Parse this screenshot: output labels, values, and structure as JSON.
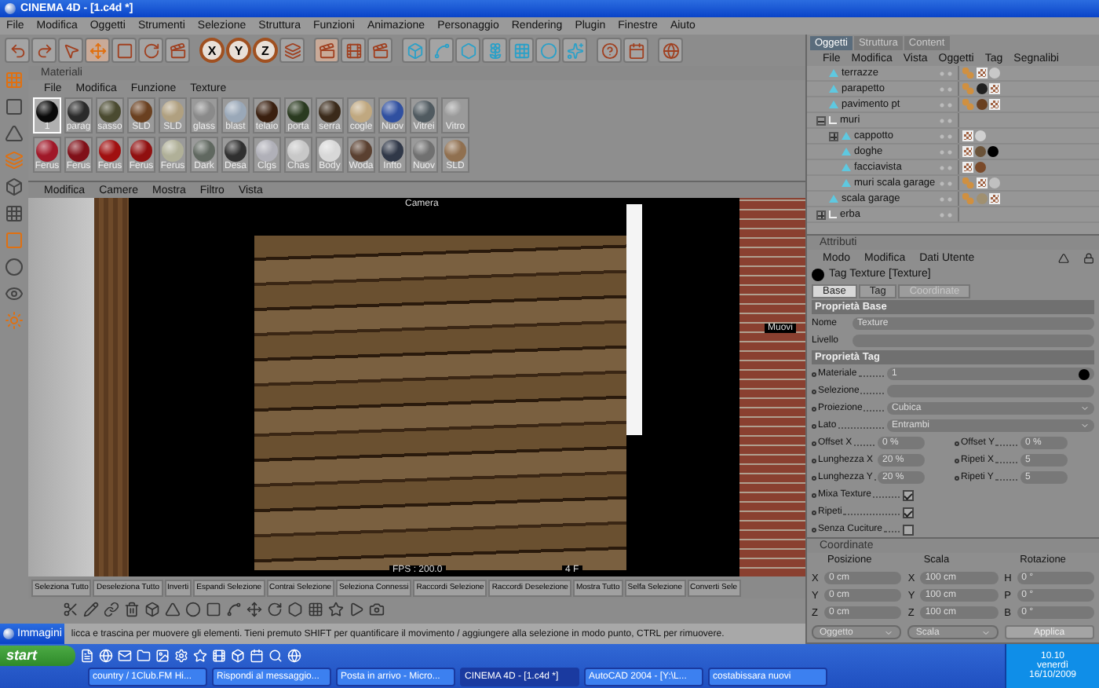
{
  "window": {
    "title": "CINEMA 4D - [1.c4d *]"
  },
  "menu": [
    "File",
    "Modifica",
    "Oggetti",
    "Strumenti",
    "Selezione",
    "Struttura",
    "Funzioni",
    "Animazione",
    "Personaggio",
    "Rendering",
    "Plugin",
    "Finestre",
    "Aiuto"
  ],
  "toolbar": {
    "axes": [
      "X",
      "Y",
      "Z"
    ]
  },
  "materials": {
    "title": "Materiali",
    "menu": [
      "File",
      "Modifica",
      "Funzione",
      "Texture"
    ],
    "rows": [
      [
        {
          "name": "1",
          "color": "#0a0a0a",
          "selected": true
        },
        {
          "name": "parag",
          "color": "#2a2a2a",
          "selected": false
        },
        {
          "name": "sasso",
          "color": "#4a4a30",
          "selected": false
        },
        {
          "name": "SLD",
          "color": "#6a4020",
          "selected": false
        },
        {
          "name": "SLD",
          "color": "#b0a080",
          "selected": false
        },
        {
          "name": "glass",
          "color": "#8a8a8a",
          "selected": false
        },
        {
          "name": "blast",
          "color": "#9aa8b8",
          "selected": false
        },
        {
          "name": "telaio",
          "color": "#3a2010",
          "selected": false
        },
        {
          "name": "porta",
          "color": "#2a3a20",
          "selected": false
        },
        {
          "name": "serra",
          "color": "#3a2a1a",
          "selected": false
        },
        {
          "name": "cogle",
          "color": "#c0a880",
          "selected": false
        },
        {
          "name": "Nuov",
          "color": "#3050a0",
          "selected": false
        },
        {
          "name": "Vitrei",
          "color": "#505a60",
          "selected": false
        },
        {
          "name": "Vitro",
          "color": "#9a9a9a",
          "selected": false
        }
      ],
      [
        {
          "name": "Ferus",
          "color": "#a01828",
          "selected": false
        },
        {
          "name": "Ferus",
          "color": "#801018",
          "selected": false
        },
        {
          "name": "Ferus",
          "color": "#a01010",
          "selected": false
        },
        {
          "name": "Ferus",
          "color": "#901010",
          "selected": false
        },
        {
          "name": "Ferus",
          "color": "#b0b098",
          "selected": false
        },
        {
          "name": "Dark",
          "color": "#606860",
          "selected": false
        },
        {
          "name": "Desa",
          "color": "#303030",
          "selected": false
        },
        {
          "name": "Clgs",
          "color": "#b0b0b8",
          "selected": false
        },
        {
          "name": "Chas",
          "color": "#c8c8c8",
          "selected": false
        },
        {
          "name": "Body",
          "color": "#d8d8d8",
          "selected": false
        },
        {
          "name": "Woda",
          "color": "#5a4030",
          "selected": false
        },
        {
          "name": "Infto",
          "color": "#303848",
          "selected": false
        },
        {
          "name": "Nuov",
          "color": "#707070",
          "selected": false
        },
        {
          "name": "SLD",
          "color": "#907050",
          "selected": false
        }
      ]
    ]
  },
  "viewport": {
    "menu": [
      "Modifica",
      "Camere",
      "Mostra",
      "Filtro",
      "Vista"
    ],
    "camera": "Camera",
    "fps": "FPS : 200.0",
    "frame": "4 F",
    "action": "Muovi"
  },
  "selection_bar": [
    "Seleziona Tutto",
    "Deseleziona Tutto",
    "Inverti",
    "Espandi Selezione",
    "Contrai Selezione",
    "Seleziona Connessi",
    "Raccordi Selezione",
    "Raccordi Deselezione",
    "Mostra Tutto",
    "Selfa Selezione",
    "Converti Sele"
  ],
  "status": {
    "window": "Immagini",
    "message": "licca e trascina per muovere gli elementi. Tieni premuto SHIFT per quantificare il movimento / aggiungere alla selezione in modo punto, CTRL per rimuovere."
  },
  "objects": {
    "tabs": [
      {
        "label": "Oggetti",
        "selected": true
      },
      {
        "label": "Struttura",
        "selected": false
      },
      {
        "label": "Content",
        "selected": false
      }
    ],
    "menu": [
      "File",
      "Modifica",
      "Vista",
      "Oggetti",
      "Tag",
      "Segnalibi"
    ],
    "items": [
      {
        "name": "terrazze",
        "kind": "polygon",
        "tags": [
          {
            "kind": "phong"
          },
          {
            "kind": "uvw"
          },
          {
            "kind": "material",
            "color": "#c8c8c8"
          }
        ]
      },
      {
        "name": "parapetto",
        "kind": "polygon",
        "tags": [
          {
            "kind": "phong"
          },
          {
            "kind": "material",
            "color": "#202020"
          },
          {
            "kind": "uvw"
          }
        ]
      },
      {
        "name": "pavimento pt",
        "kind": "polygon",
        "tags": [
          {
            "kind": "phong"
          },
          {
            "kind": "material",
            "color": "#6a4020"
          },
          {
            "kind": "uvw"
          }
        ]
      },
      {
        "name": "muri",
        "kind": "null",
        "expanded": true,
        "children": [
          {
            "name": "cappotto",
            "kind": "polygon",
            "expanded": false,
            "tags": [
              {
                "kind": "uvw"
              },
              {
                "kind": "material",
                "color": "#d0d0d0"
              }
            ]
          },
          {
            "name": "doghe",
            "kind": "polygon",
            "tags": [
              {
                "kind": "uvw"
              },
              {
                "kind": "material",
                "color": "#6a5238"
              },
              {
                "kind": "material",
                "color": "#000000"
              }
            ]
          },
          {
            "name": "facciavista",
            "kind": "polygon",
            "tags": [
              {
                "kind": "uvw"
              },
              {
                "kind": "material",
                "color": "#7a4a2a"
              }
            ]
          },
          {
            "name": "muri scala garage",
            "kind": "polygon",
            "tags": [
              {
                "kind": "phong"
              },
              {
                "kind": "uvw"
              },
              {
                "kind": "material",
                "color": "#c0c0c0"
              }
            ]
          }
        ]
      },
      {
        "name": "scala garage",
        "kind": "polygon",
        "tags": [
          {
            "kind": "phong"
          },
          {
            "kind": "material",
            "color": "#a09070"
          },
          {
            "kind": "uvw"
          }
        ]
      },
      {
        "name": "erba",
        "kind": "null",
        "expanded": false
      }
    ]
  },
  "attributes": {
    "title": "Attributi",
    "menu": [
      "Modo",
      "Modifica",
      "Dati Utente"
    ],
    "tag_title": "Tag Texture [Texture]",
    "tabs": [
      {
        "label": "Base",
        "selected": true,
        "disabled": false
      },
      {
        "label": "Tag",
        "selected": false,
        "disabled": false
      },
      {
        "label": "Coordinate",
        "selected": false,
        "disabled": true
      }
    ],
    "sections": [
      {
        "title": "Proprietà Base",
        "fields": [
          {
            "kind": "text",
            "label": "Nome",
            "value": "Texture"
          },
          {
            "kind": "text",
            "label": "Livello"
          }
        ]
      },
      {
        "title": "Proprietà Tag",
        "fields": [
          {
            "kind": "link",
            "label": "Materiale",
            "value": "1",
            "color": "#000000"
          },
          {
            "kind": "link",
            "label": "Selezione"
          },
          {
            "kind": "dropdown",
            "label": "Proiezione",
            "value": "Cubica"
          },
          {
            "kind": "dropdown",
            "label": "Lato",
            "value": "Entrambi"
          },
          {
            "kind": "pair",
            "items": [
              {
                "label": "Offset X",
                "value": "0 %"
              },
              {
                "label": "Offset Y",
                "value": "0 %"
              }
            ]
          },
          {
            "kind": "pair",
            "items": [
              {
                "label": "Lunghezza X",
                "value": "20 %"
              },
              {
                "label": "Ripeti X",
                "value": "5"
              }
            ]
          },
          {
            "kind": "pair",
            "items": [
              {
                "label": "Lunghezza Y",
                "value": "20 %"
              },
              {
                "label": "Ripeti Y",
                "value": "5"
              }
            ]
          },
          {
            "kind": "checkbox",
            "label": "Mixa Texture",
            "checked": true
          },
          {
            "kind": "checkbox",
            "label": "Ripeti",
            "checked": true
          },
          {
            "kind": "checkbox",
            "label": "Senza Cuciture",
            "checked": false
          }
        ]
      }
    ]
  },
  "coordinates": {
    "title": "Coordinate",
    "columns": [
      {
        "title": "Posizione",
        "rows": [
          {
            "axis": "X",
            "value": "0 cm"
          },
          {
            "axis": "Y",
            "value": "0 cm"
          },
          {
            "axis": "Z",
            "value": "0 cm"
          }
        ]
      },
      {
        "title": "Scala",
        "rows": [
          {
            "axis": "X",
            "value": "100 cm"
          },
          {
            "axis": "Y",
            "value": "100 cm"
          },
          {
            "axis": "Z",
            "value": "100 cm"
          }
        ]
      },
      {
        "title": "Rotazione",
        "rows": [
          {
            "axis": "H",
            "value": "0 °"
          },
          {
            "axis": "P",
            "value": "0 °"
          },
          {
            "axis": "B",
            "value": "0 °"
          }
        ]
      }
    ],
    "dropdowns": [
      "Oggetto",
      "Scala"
    ],
    "button": "Applica"
  },
  "taskbar": {
    "start": "start",
    "tasks": [
      {
        "label": "country / 1Club.FM Hi...",
        "selected": false
      },
      {
        "label": "Rispondi al messaggio...",
        "selected": false
      },
      {
        "label": "Posta in arrivo - Micro...",
        "selected": false
      },
      {
        "label": "CINEMA 4D - [1.c4d *]",
        "selected": true
      },
      {
        "label": "AutoCAD 2004 - [Y:\\L...",
        "selected": false
      },
      {
        "label": "costabissara nuovi",
        "selected": false
      }
    ],
    "time": "10.10",
    "day": "venerdì",
    "date": "16/10/2009"
  }
}
